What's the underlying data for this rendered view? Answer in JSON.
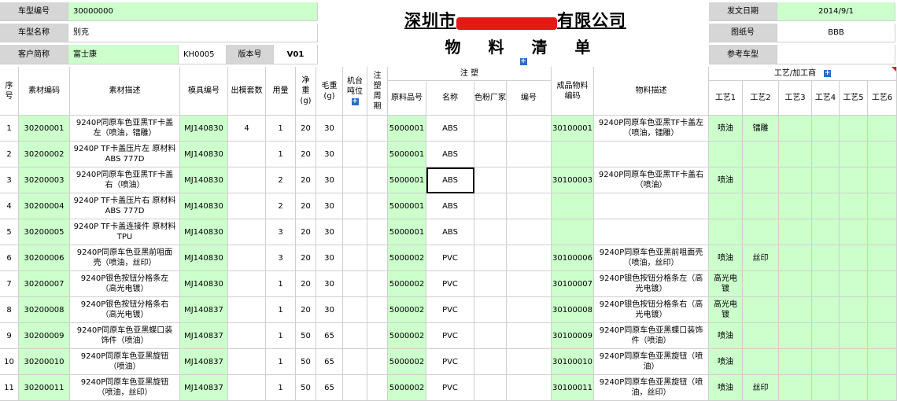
{
  "info": {
    "vehicle_no_label": "车型编号",
    "vehicle_no": "30000000",
    "vehicle_name_label": "车型名称",
    "vehicle_name": "别克",
    "customer_label": "客户简称",
    "customer": "富士康",
    "customer_code": "KH0005",
    "version_label": "版本号",
    "version": "V01",
    "issue_date_label": "发文日期",
    "issue_date": "2014/9/1",
    "drawing_no_label": "图纸号",
    "drawing_no": "BBB",
    "ref_vehicle_label": "参考车型",
    "ref_vehicle": ""
  },
  "title": {
    "company_prefix": "深圳市",
    "company_suffix": "有限公司",
    "doc_title": "物 料 清 单",
    "plus_icon": "+"
  },
  "headers": {
    "seq": "序号",
    "mat_code": "素材编码",
    "mat_desc": "素材描述",
    "mold_no": "模具编号",
    "cavity": "出模套数",
    "usage": "用量",
    "net": "净重(g)",
    "gross": "毛重(g)",
    "machine": "机台吨位",
    "cycle": "注塑周期",
    "injection": "注 塑",
    "raw_no": "原料品号",
    "name": "名称",
    "color": "色粉厂家",
    "code": "编号",
    "prod_code": "成品物料编码",
    "prod_desc": "物料描述",
    "process": "工艺/加工商",
    "p1": "工艺1",
    "p2": "工艺2",
    "p3": "工艺3",
    "p4": "工艺4",
    "p5": "工艺5",
    "p6": "工艺6"
  },
  "rows": [
    {
      "seq": "1",
      "code": "30200001",
      "desc": "9240P同原车色亚黑TF卡盖左（喷油，镭雕）",
      "mold": "MJ140830",
      "cav": "4",
      "use": "1",
      "net": "20",
      "gross": "30",
      "raw": "5000001",
      "name": "ABS",
      "pcode": "30100001",
      "pdesc": "9240P同原车色亚黑TF卡盖左（喷油，镭雕）",
      "p1": "喷油",
      "p2": "镭雕"
    },
    {
      "seq": "2",
      "code": "30200002",
      "desc": "9240P TF卡盖压片左 原材料 ABS 777D",
      "mold": "MJ140830",
      "cav": "",
      "use": "1",
      "net": "20",
      "gross": "30",
      "raw": "5000001",
      "name": "ABS",
      "pcode": "",
      "pdesc": "",
      "p1": "",
      "p2": ""
    },
    {
      "seq": "3",
      "code": "30200003",
      "desc": "9240P同原车色亚黑TF卡盖右（喷油）",
      "mold": "MJ140830",
      "cav": "",
      "use": "2",
      "net": "20",
      "gross": "30",
      "raw": "5000001",
      "name": "ABS",
      "pcode": "30100003",
      "pdesc": "9240P同原车色亚黑TF卡盖右（喷油）",
      "p1": "喷油",
      "p2": ""
    },
    {
      "seq": "4",
      "code": "30200004",
      "desc": "9240P TF卡盖压片右 原材料 ABS 777D",
      "mold": "MJ140830",
      "cav": "",
      "use": "2",
      "net": "20",
      "gross": "30",
      "raw": "5000001",
      "name": "ABS",
      "pcode": "",
      "pdesc": "",
      "p1": "",
      "p2": ""
    },
    {
      "seq": "5",
      "code": "30200005",
      "desc": "9240P TF卡盖连接件 原材料 TPU",
      "mold": "MJ140830",
      "cav": "",
      "use": "3",
      "net": "20",
      "gross": "30",
      "raw": "5000001",
      "name": "ABS",
      "pcode": "",
      "pdesc": "",
      "p1": "",
      "p2": ""
    },
    {
      "seq": "6",
      "code": "30200006",
      "desc": "9240P同原车色亚黑前咀面壳（喷油，丝印）",
      "mold": "MJ140830",
      "cav": "",
      "use": "3",
      "net": "20",
      "gross": "30",
      "raw": "5000002",
      "name": "PVC",
      "pcode": "30100006",
      "pdesc": "9240P同原车色亚黑前咀面壳（喷油，丝印）",
      "p1": "喷油",
      "p2": "丝印"
    },
    {
      "seq": "7",
      "code": "30200007",
      "desc": "9240P银色按钮分格条左（高光电镀）",
      "mold": "MJ140830",
      "cav": "",
      "use": "1",
      "net": "20",
      "gross": "30",
      "raw": "5000002",
      "name": "PVC",
      "pcode": "30100007",
      "pdesc": "9240P银色按钮分格条左（高光电镀）",
      "p1": "高光电镀",
      "p2": ""
    },
    {
      "seq": "8",
      "code": "30200008",
      "desc": "9240P银色按钮分格条右（高光电镀）",
      "mold": "MJ140837",
      "cav": "",
      "use": "1",
      "net": "20",
      "gross": "30",
      "raw": "5000002",
      "name": "PVC",
      "pcode": "30100008",
      "pdesc": "9240P银色按钮分格条右（高光电镀）",
      "p1": "高光电镀",
      "p2": ""
    },
    {
      "seq": "9",
      "code": "30200009",
      "desc": "9240P同原车色亚黑蝶口装饰件（喷油）",
      "mold": "MJ140837",
      "cav": "",
      "use": "1",
      "net": "50",
      "gross": "65",
      "raw": "5000002",
      "name": "PVC",
      "pcode": "30100009",
      "pdesc": "9240P同原车色亚黑蝶口装饰件（喷油）",
      "p1": "喷油",
      "p2": ""
    },
    {
      "seq": "10",
      "code": "30200010",
      "desc": "9240P同原车色亚黑旋钮（喷油）",
      "mold": "MJ140837",
      "cav": "",
      "use": "1",
      "net": "50",
      "gross": "65",
      "raw": "5000002",
      "name": "PVC",
      "pcode": "30100010",
      "pdesc": "9240P同原车色亚黑旋钮（喷油）",
      "p1": "喷油",
      "p2": ""
    },
    {
      "seq": "11",
      "code": "30200011",
      "desc": "9240P同原车色亚黑旋钮（喷油，丝印）",
      "mold": "MJ140837",
      "cav": "",
      "use": "1",
      "net": "50",
      "gross": "65",
      "raw": "5000002",
      "name": "PVC",
      "pcode": "30100011",
      "pdesc": "9240P同原车色亚黑旋钮（喷油，丝印）",
      "p1": "喷油",
      "p2": "丝印"
    }
  ],
  "colors": {
    "label_bg": "#d6d6d6",
    "value_bg": "#ccffcc",
    "accent": "#2a6cc4",
    "redaction": "#e21919"
  }
}
